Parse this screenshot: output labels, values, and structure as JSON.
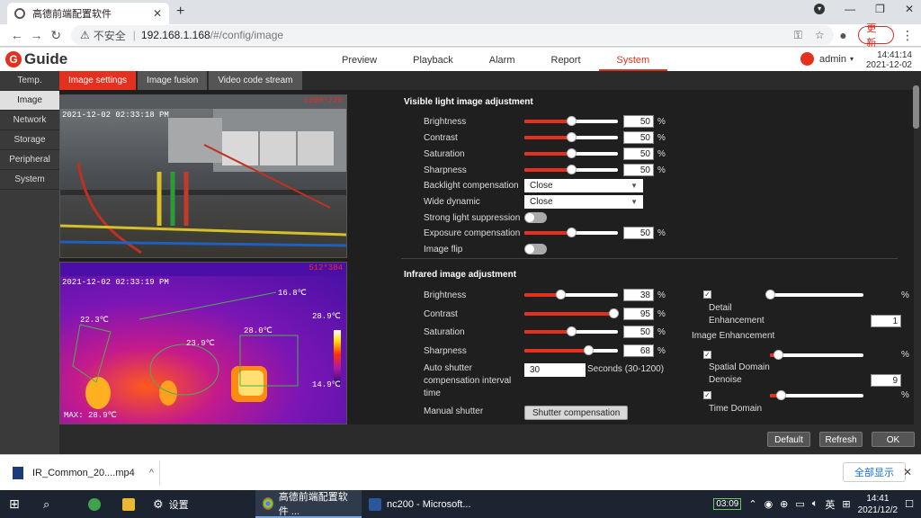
{
  "browser": {
    "tab_title": "高德前端配置软件",
    "new_tab": "+",
    "close": "✕",
    "address_warning": "不安全",
    "address_host": "192.168.1.168",
    "address_path": "/#/config/image",
    "update_label": "更新"
  },
  "app": {
    "logo_text": "Guide",
    "nav": [
      "Preview",
      "Playback",
      "Alarm",
      "Report",
      "System"
    ],
    "active_nav": "System",
    "user": "admin",
    "time": "14:41:14",
    "date": "2021-12-02",
    "side_nav": [
      "Temp.",
      "Image",
      "Network",
      "Storage",
      "Peripheral",
      "System"
    ],
    "active_side": "Image",
    "sub_tabs": [
      "Image settings",
      "Image fusion",
      "Video code stream"
    ],
    "active_sub_tab": "Image settings"
  },
  "video": {
    "visible_res": "1280*720",
    "visible_stamp": "2021-12-02 02:33:18 PM",
    "ir_res": "512*384",
    "ir_stamp": "2021-12-02 02:33:19 PM",
    "ir_labels": [
      "16.8℃",
      "22.3℃",
      "23.9℃",
      "28.0℃",
      "28.9℃",
      "14.9℃",
      "MAX: 28.9℃"
    ]
  },
  "visible": {
    "title": "Visible light image adjustment",
    "sliders": [
      {
        "label": "Brightness",
        "value": 50
      },
      {
        "label": "Contrast",
        "value": 50
      },
      {
        "label": "Saturation",
        "value": 50
      },
      {
        "label": "Sharpness",
        "value": 50
      }
    ],
    "backlight_label": "Backlight compensation",
    "backlight_value": "Close",
    "wide_dynamic_label": "Wide dynamic",
    "wide_dynamic_value": "Close",
    "strong_light_label": "Strong light suppression",
    "exposure_label": "Exposure compensation",
    "exposure_value": 50,
    "image_flip_label": "Image flip"
  },
  "infrared": {
    "title": "Infrared image adjustment",
    "sliders": [
      {
        "label": "Brightness",
        "value": 38
      },
      {
        "label": "Contrast",
        "value": 95
      },
      {
        "label": "Saturation",
        "value": 50
      },
      {
        "label": "Sharpness",
        "value": 68
      }
    ],
    "auto_shutter_label_1": "Auto shutter",
    "auto_shutter_label_2": "compensation interval",
    "auto_shutter_label_3": "time",
    "auto_shutter_value": "30",
    "auto_shutter_unit": "Seconds (30-1200)",
    "manual_shutter_label": "Manual shutter",
    "manual_shutter_button": "Shutter compensation"
  },
  "enhancement": {
    "detail_label_1": "Detail",
    "detail_label_2": "Enhancement",
    "detail_value": "1",
    "detail_slider": 0,
    "group_label": "Image Enhancement",
    "spatial_label_1": "Spatial Domain",
    "spatial_label_2": "Denoise",
    "spatial_value": "9",
    "spatial_slider": 9,
    "time_label": "Time Domain",
    "time_slider": 12,
    "pct": "%"
  },
  "footer": {
    "default": "Default",
    "refresh": "Refresh",
    "ok": "OK"
  },
  "download": {
    "filename": "IR_Common_20....mp4",
    "show_all": "全部显示"
  },
  "taskbar": {
    "settings": "设置",
    "chrome_app": "高德前端配置软件 ...",
    "word_app": "nc200 - Microsoft...",
    "timer": "03:09",
    "ime": "英",
    "time": "14:41",
    "date": "2021/12/2"
  },
  "colors": {
    "accent": "#e3301f"
  }
}
